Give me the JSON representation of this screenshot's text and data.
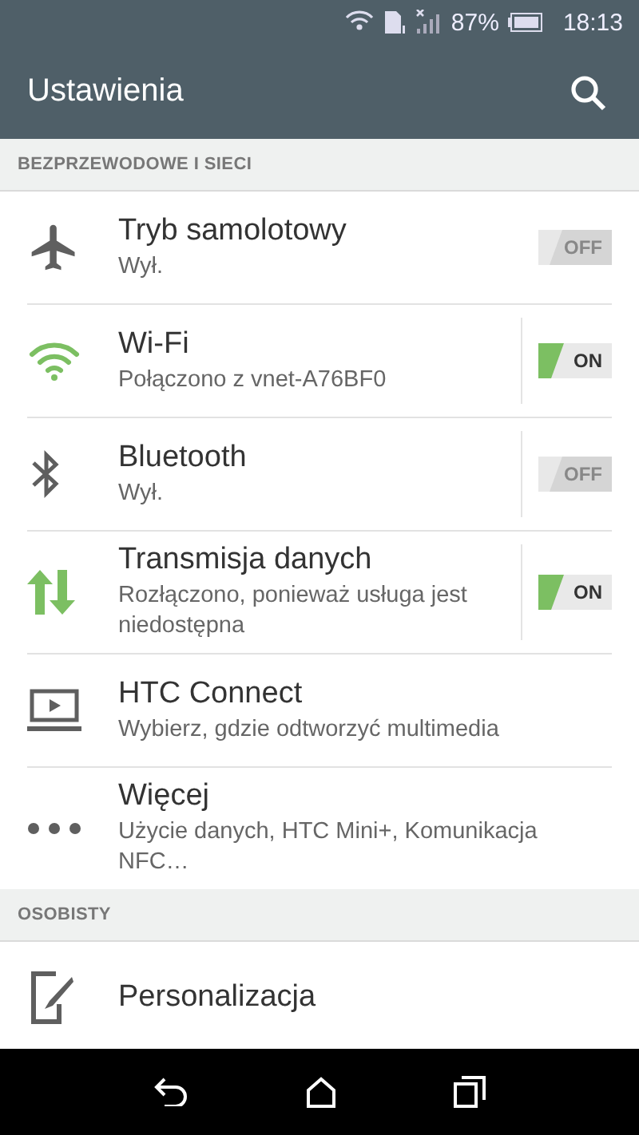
{
  "status_bar": {
    "battery": "87%",
    "time": "18:13"
  },
  "header": {
    "title": "Ustawienia"
  },
  "sections": [
    {
      "title": "BEZPRZEWODOWE I SIECI",
      "items": [
        {
          "kind": "toggle",
          "title": "Tryb samolotowy",
          "subtitle": "Wył.",
          "on": false,
          "split": false,
          "toggle_label": "OFF"
        },
        {
          "kind": "toggle",
          "title": "Wi-Fi",
          "subtitle": "Połączono z vnet-A76BF0",
          "on": true,
          "split": true,
          "toggle_label": "ON"
        },
        {
          "kind": "toggle",
          "title": "Bluetooth",
          "subtitle": "Wył.",
          "on": false,
          "split": true,
          "toggle_label": "OFF"
        },
        {
          "kind": "toggle",
          "title": "Transmisja danych",
          "subtitle": "Rozłączono, ponieważ usługa jest niedostępna",
          "on": true,
          "split": true,
          "toggle_label": "ON"
        },
        {
          "kind": "plain",
          "title": "HTC Connect",
          "subtitle": "Wybierz, gdzie odtworzyć multimedia"
        },
        {
          "kind": "plain",
          "title": "Więcej",
          "subtitle": "Użycie danych, HTC Mini+, Komunikacja NFC…"
        }
      ]
    },
    {
      "title": "OSOBISTY",
      "items": [
        {
          "kind": "plain",
          "title": "Personalizacja"
        }
      ]
    }
  ]
}
